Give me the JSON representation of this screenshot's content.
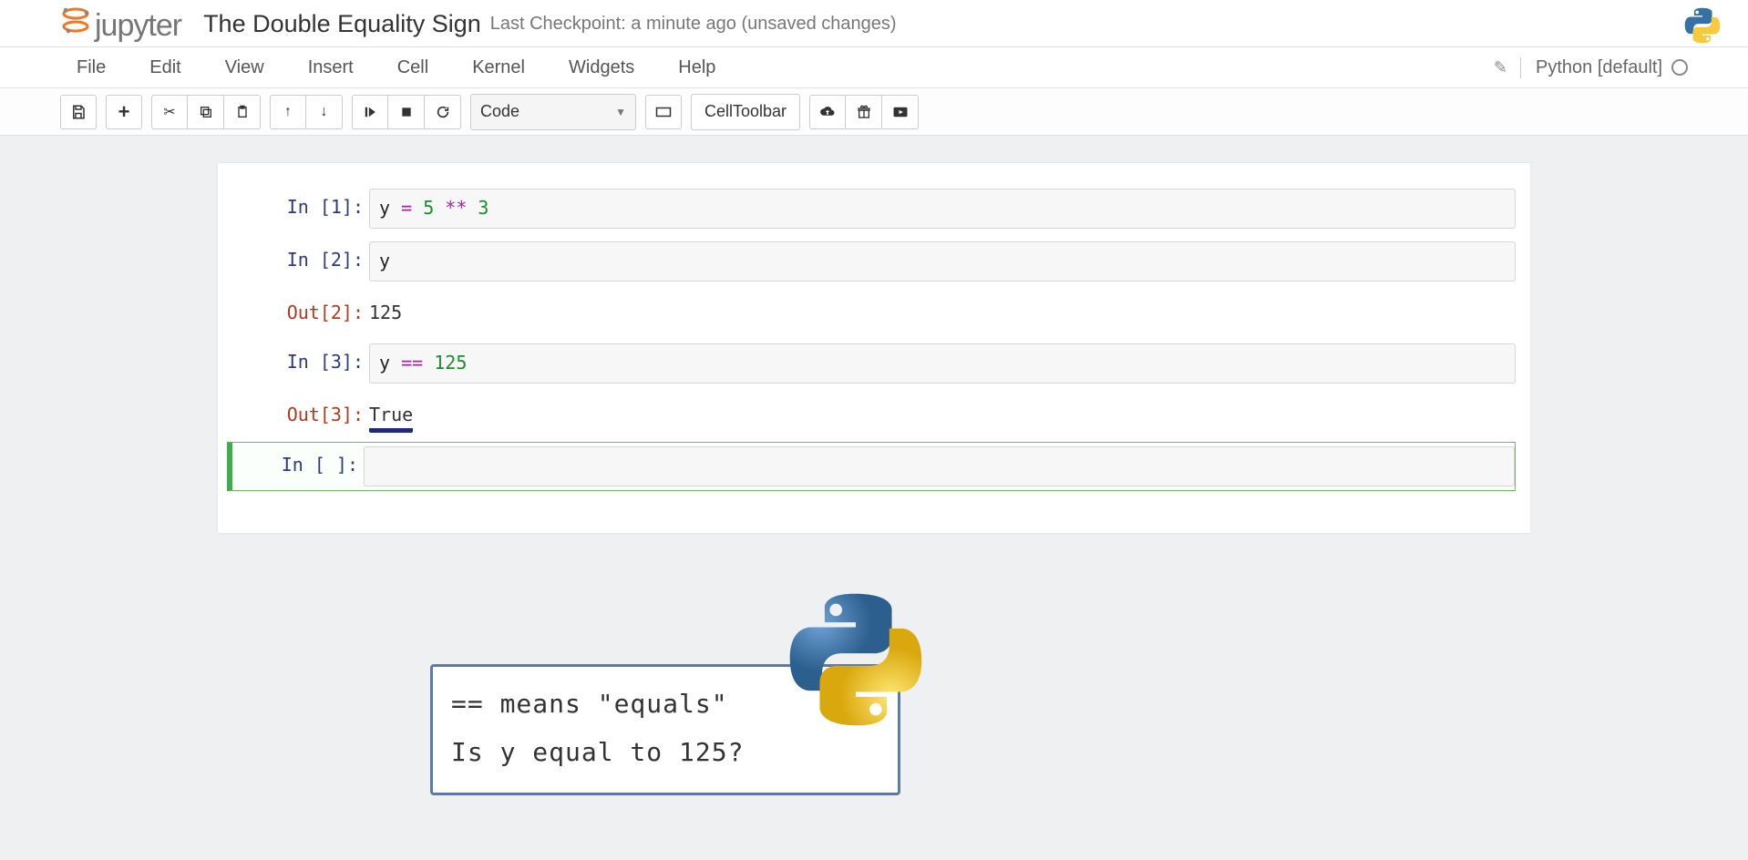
{
  "logo": {
    "word": "jupyter"
  },
  "header": {
    "title": "The Double Equality Sign",
    "checkpoint": "Last Checkpoint: a minute ago (unsaved changes)"
  },
  "menubar": {
    "items": [
      "File",
      "Edit",
      "View",
      "Insert",
      "Cell",
      "Kernel",
      "Widgets",
      "Help"
    ],
    "kernel_name": "Python [default]"
  },
  "toolbar": {
    "celltype": "Code",
    "celltoolbar_label": "CellToolbar"
  },
  "cells": [
    {
      "in_prompt": "In [1]:",
      "code_tokens": [
        {
          "t": "y",
          "c": "tok-name"
        },
        {
          "t": " ",
          "c": ""
        },
        {
          "t": "=",
          "c": "tok-op"
        },
        {
          "t": " ",
          "c": ""
        },
        {
          "t": "5",
          "c": "tok-num"
        },
        {
          "t": " ",
          "c": ""
        },
        {
          "t": "**",
          "c": "tok-op"
        },
        {
          "t": " ",
          "c": ""
        },
        {
          "t": "3",
          "c": "tok-num"
        }
      ]
    },
    {
      "in_prompt": "In [2]:",
      "code_tokens": [
        {
          "t": "y",
          "c": "tok-name"
        }
      ],
      "out_prompt": "Out[2]:",
      "output": "125"
    },
    {
      "in_prompt": "In [3]:",
      "code_tokens": [
        {
          "t": "y",
          "c": "tok-name"
        },
        {
          "t": " ",
          "c": ""
        },
        {
          "t": "==",
          "c": "tok-op"
        },
        {
          "t": " ",
          "c": ""
        },
        {
          "t": "125",
          "c": "tok-num"
        }
      ],
      "out_prompt": "Out[3]:",
      "output": "True",
      "output_underlined": true
    },
    {
      "in_prompt": "In [ ]:",
      "code_tokens": [],
      "selected": true
    }
  ],
  "annotation": {
    "line1": "== means \"equals\"",
    "line2": "Is y equal to 125?"
  }
}
